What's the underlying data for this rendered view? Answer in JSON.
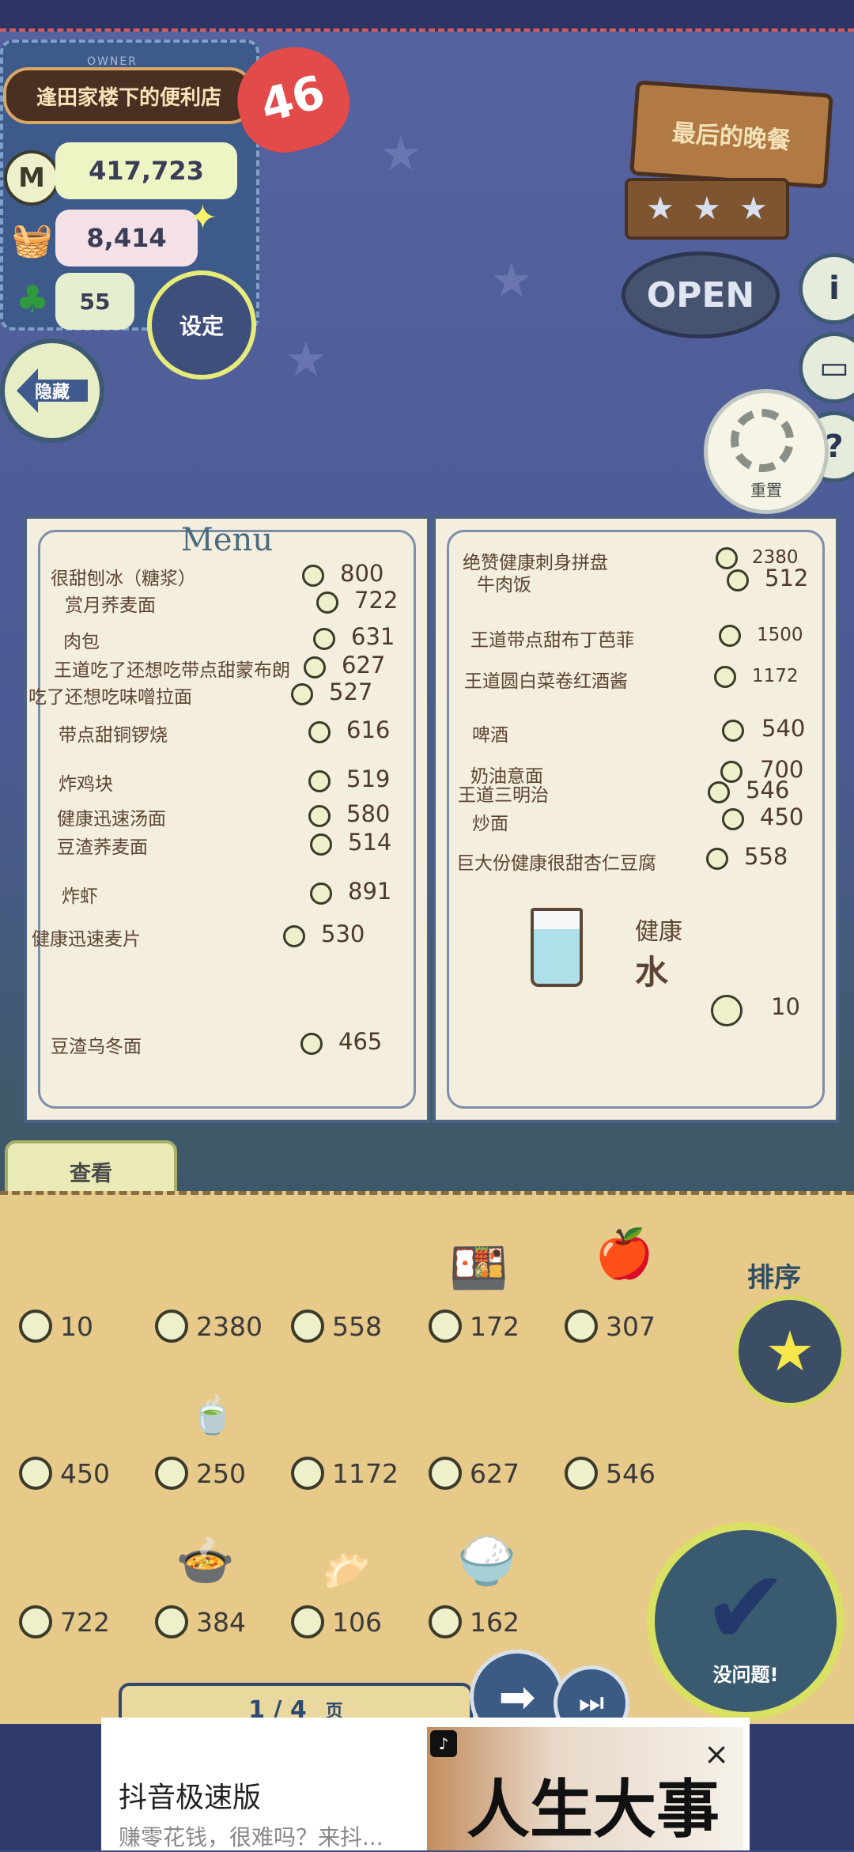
{
  "owner": {
    "label": "OWNER",
    "shop_name": "逢田家楼下的便利店",
    "level": "46",
    "coins": "417,723",
    "food": "8,414",
    "clover": "55"
  },
  "buttons": {
    "settings": "设定",
    "hide": "隐藏",
    "reset": "重置",
    "view": "查看",
    "sort": "排序",
    "confirm": "没问题!"
  },
  "sign": {
    "title": "最后的晚餐",
    "status": "OPEN",
    "stars": 3
  },
  "menu_left": {
    "title": "Menu",
    "items": [
      {
        "name": "很甜刨冰（糖浆）",
        "price": "800"
      },
      {
        "name": "赏月荞麦面",
        "price": "722"
      },
      {
        "name": "肉包",
        "price": "631"
      },
      {
        "name": "王道吃了还想吃带点甜蒙布朗",
        "price": "627"
      },
      {
        "name": "吃了还想吃味噌拉面",
        "price": "527"
      },
      {
        "name": "带点甜铜锣烧",
        "price": "616"
      },
      {
        "name": "炸鸡块",
        "price": "519"
      },
      {
        "name": "健康迅速汤面",
        "price": "580"
      },
      {
        "name": "豆渣荞麦面",
        "price": "514"
      },
      {
        "name": "炸虾",
        "price": "891"
      },
      {
        "name": "健康迅速麦片",
        "price": "530"
      },
      {
        "name": "豆渣乌冬面",
        "price": "465"
      }
    ]
  },
  "menu_right": {
    "items": [
      {
        "name": "绝赞健康刺身拼盘",
        "price": "2380"
      },
      {
        "name": "牛肉饭",
        "price": "512"
      },
      {
        "name": "王道带点甜布丁芭菲",
        "price": "1500"
      },
      {
        "name": "王道圆白菜卷红酒酱",
        "price": "1172"
      },
      {
        "name": "啤酒",
        "price": "540"
      },
      {
        "name": "奶油意面",
        "price": "700"
      },
      {
        "name": "王道三明治",
        "price": "546"
      },
      {
        "name": "炒面",
        "price": "450"
      },
      {
        "name": "巨大份健康很甜杏仁豆腐",
        "price": "558"
      }
    ],
    "special": {
      "qualifier": "健康",
      "name": "水",
      "price": "10"
    }
  },
  "tray": {
    "prices": [
      "10",
      "2380",
      "558",
      "172",
      "307",
      "450",
      "250",
      "1172",
      "627",
      "546",
      "722",
      "384",
      "106",
      "162"
    ]
  },
  "pager": {
    "page": "1 / 4",
    "unit": "页"
  },
  "ad": {
    "title": "抖音极速版",
    "subtitle": "赚零花钱，很难吗？来抖...",
    "art_text": "人生大事"
  },
  "icons": {
    "coin": "coin-icon",
    "food": "food-basket-icon",
    "clover": "clover-icon",
    "settings": "gear-icon",
    "info": "info-icon",
    "book": "book-icon",
    "help": "help-icon",
    "sort": "star-icon",
    "confirm": "check-icon"
  },
  "colors": {
    "accent": "#d9e063",
    "heart": "#e34b4b",
    "menu_paper": "#f3eedd",
    "tray": "#e7c98a"
  }
}
